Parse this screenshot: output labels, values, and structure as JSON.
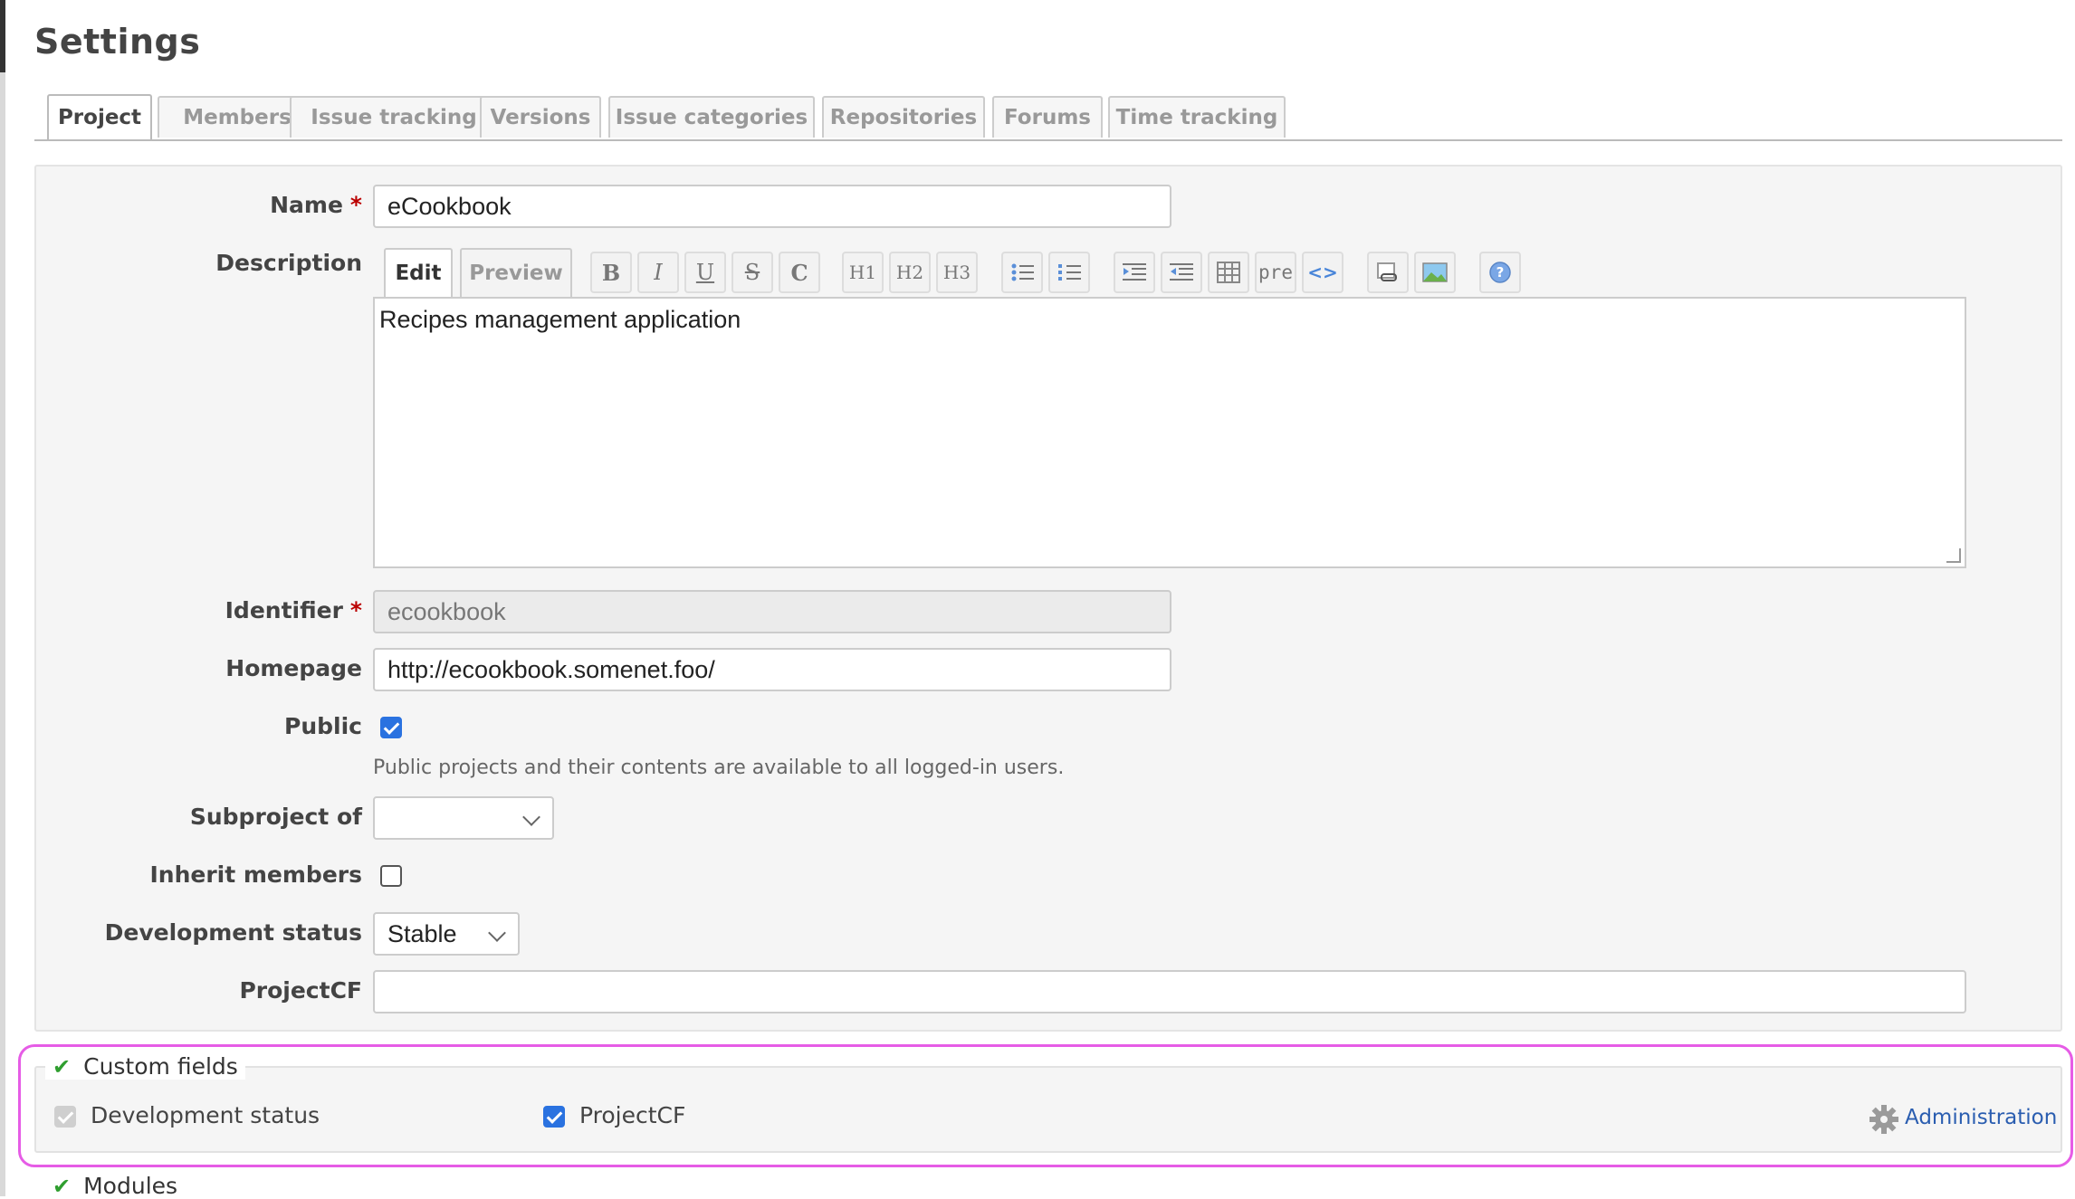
{
  "page": {
    "title": "Settings"
  },
  "tabs": [
    "Project",
    "Members",
    "Issue tracking",
    "Versions",
    "Issue categories",
    "Repositories",
    "Forums",
    "Time tracking"
  ],
  "form": {
    "name_label": "Name",
    "name_value": "eCookbook",
    "description_label": "Description",
    "editor_tabs": {
      "edit": "Edit",
      "preview": "Preview"
    },
    "toolbar": [
      "B",
      "I",
      "U",
      "S",
      "C",
      "H1",
      "H2",
      "H3",
      "ul",
      "ol",
      "indent",
      "outdent",
      "table",
      "pre",
      "code",
      "link",
      "image",
      "help"
    ],
    "toolbar_pre": "pre",
    "description_value": "Recipes management application",
    "identifier_label": "Identifier",
    "identifier_value": "ecookbook",
    "homepage_label": "Homepage",
    "homepage_value": "http://ecookbook.somenet.foo/",
    "public_label": "Public",
    "public_checked": true,
    "public_hint": "Public projects and their contents are available to all logged-in users.",
    "subproject_label": "Subproject of",
    "subproject_value": "",
    "inherit_label": "Inherit members",
    "inherit_checked": false,
    "devstatus_label": "Development status",
    "devstatus_value": "Stable",
    "projectcf_label": "ProjectCF",
    "projectcf_value": "",
    "required_marker": "*"
  },
  "custom_fields": {
    "legend": "Custom fields",
    "items": [
      {
        "label": "Development status",
        "checked": true,
        "disabled": true
      },
      {
        "label": "ProjectCF",
        "checked": true,
        "disabled": false
      }
    ],
    "admin_link": "Administration"
  },
  "modules": {
    "legend": "Modules"
  },
  "colors": {
    "highlight": "#e65ce6",
    "link": "#2a5db0",
    "required": "#bb0000",
    "checkbox": "#2a72e0"
  }
}
